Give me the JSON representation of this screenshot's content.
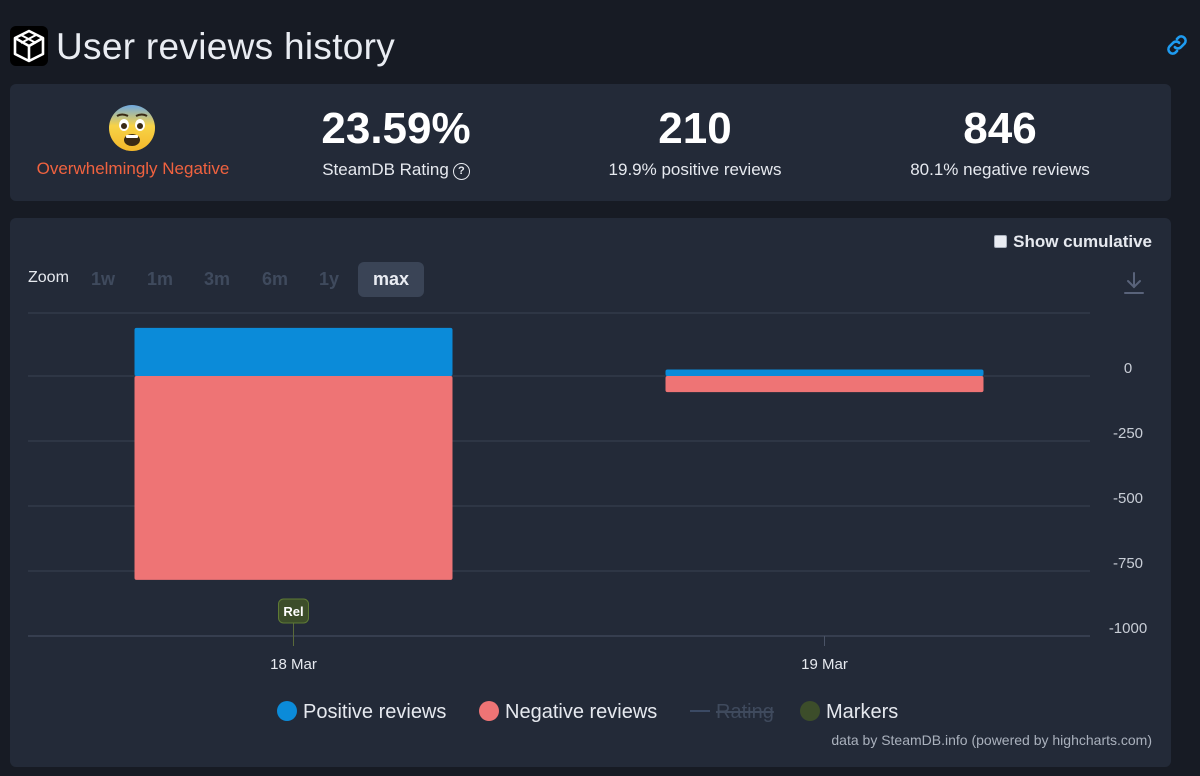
{
  "header": {
    "title": "User reviews history"
  },
  "summary": {
    "verdict": "Overwhelmingly Negative",
    "rating_value": "23.59%",
    "rating_label": "SteamDB Rating",
    "positive_count": "210",
    "positive_label": "19.9% positive reviews",
    "negative_count": "846",
    "negative_label": "80.1% negative reviews"
  },
  "controls": {
    "cumulative_label": "Show cumulative",
    "zoom_label": "Zoom",
    "zoom_options": [
      "1w",
      "1m",
      "3m",
      "6m",
      "1y",
      "max"
    ],
    "zoom_selected": "max"
  },
  "chart_data": {
    "type": "bar",
    "title": "",
    "xlabel": "",
    "ylabel": "",
    "categories": [
      "18 Mar",
      "19 Mar"
    ],
    "series": [
      {
        "name": "Positive reviews",
        "color": "#0b8bd9",
        "values": [
          185,
          25
        ]
      },
      {
        "name": "Negative reviews",
        "color": "#ee7475",
        "values": [
          -784,
          -62
        ]
      }
    ],
    "stacking": "normal",
    "ylim": [
      -1000,
      250
    ],
    "y_ticks": [
      0,
      -250,
      -500,
      -750,
      -1000
    ],
    "y_tick_labels": [
      "0",
      "-250",
      "-500",
      "-750",
      "-1000"
    ],
    "markers": [
      {
        "category": "18 Mar",
        "label": "Rel"
      }
    ],
    "grid": true,
    "legend_position": "bottom-center"
  },
  "legend": [
    {
      "label": "Positive reviews",
      "color": "#0b8bd9",
      "kind": "dot",
      "hidden": false
    },
    {
      "label": "Negative reviews",
      "color": "#ee7475",
      "kind": "dot",
      "hidden": false
    },
    {
      "label": "Rating",
      "color": "#3b4a64",
      "kind": "line",
      "hidden": true
    },
    {
      "label": "Markers",
      "color": "#3c4d2a",
      "kind": "dot",
      "hidden": false
    }
  ],
  "credits": "data by SteamDB.info (powered by highcharts.com)",
  "icons": {
    "link": "link-icon",
    "download": "download-icon",
    "logo": "steamdb-logo",
    "help": "help-icon"
  }
}
